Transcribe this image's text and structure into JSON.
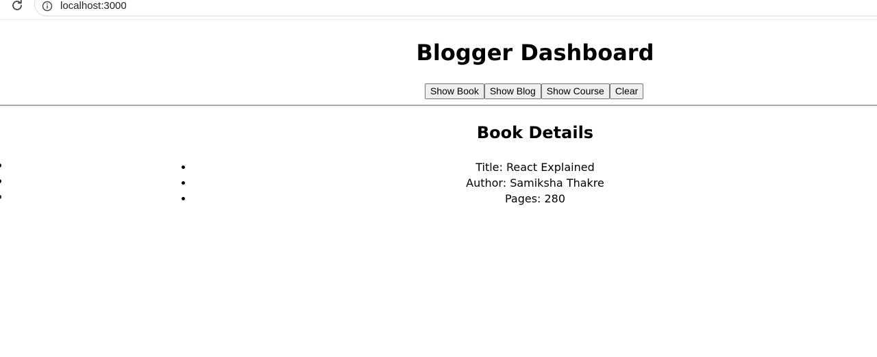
{
  "browser": {
    "url": "localhost:3000",
    "reload_icon": "reload-icon",
    "info_icon": "info-icon"
  },
  "header": {
    "title": "Blogger Dashboard"
  },
  "toolbar": {
    "buttons": [
      {
        "label": "Show Book"
      },
      {
        "label": "Show Blog"
      },
      {
        "label": "Show Course"
      },
      {
        "label": "Clear"
      }
    ]
  },
  "details": {
    "title": "Book Details",
    "items": [
      "Title: React Explained",
      "Author: Samiksha Thakre",
      "Pages: 280"
    ]
  }
}
